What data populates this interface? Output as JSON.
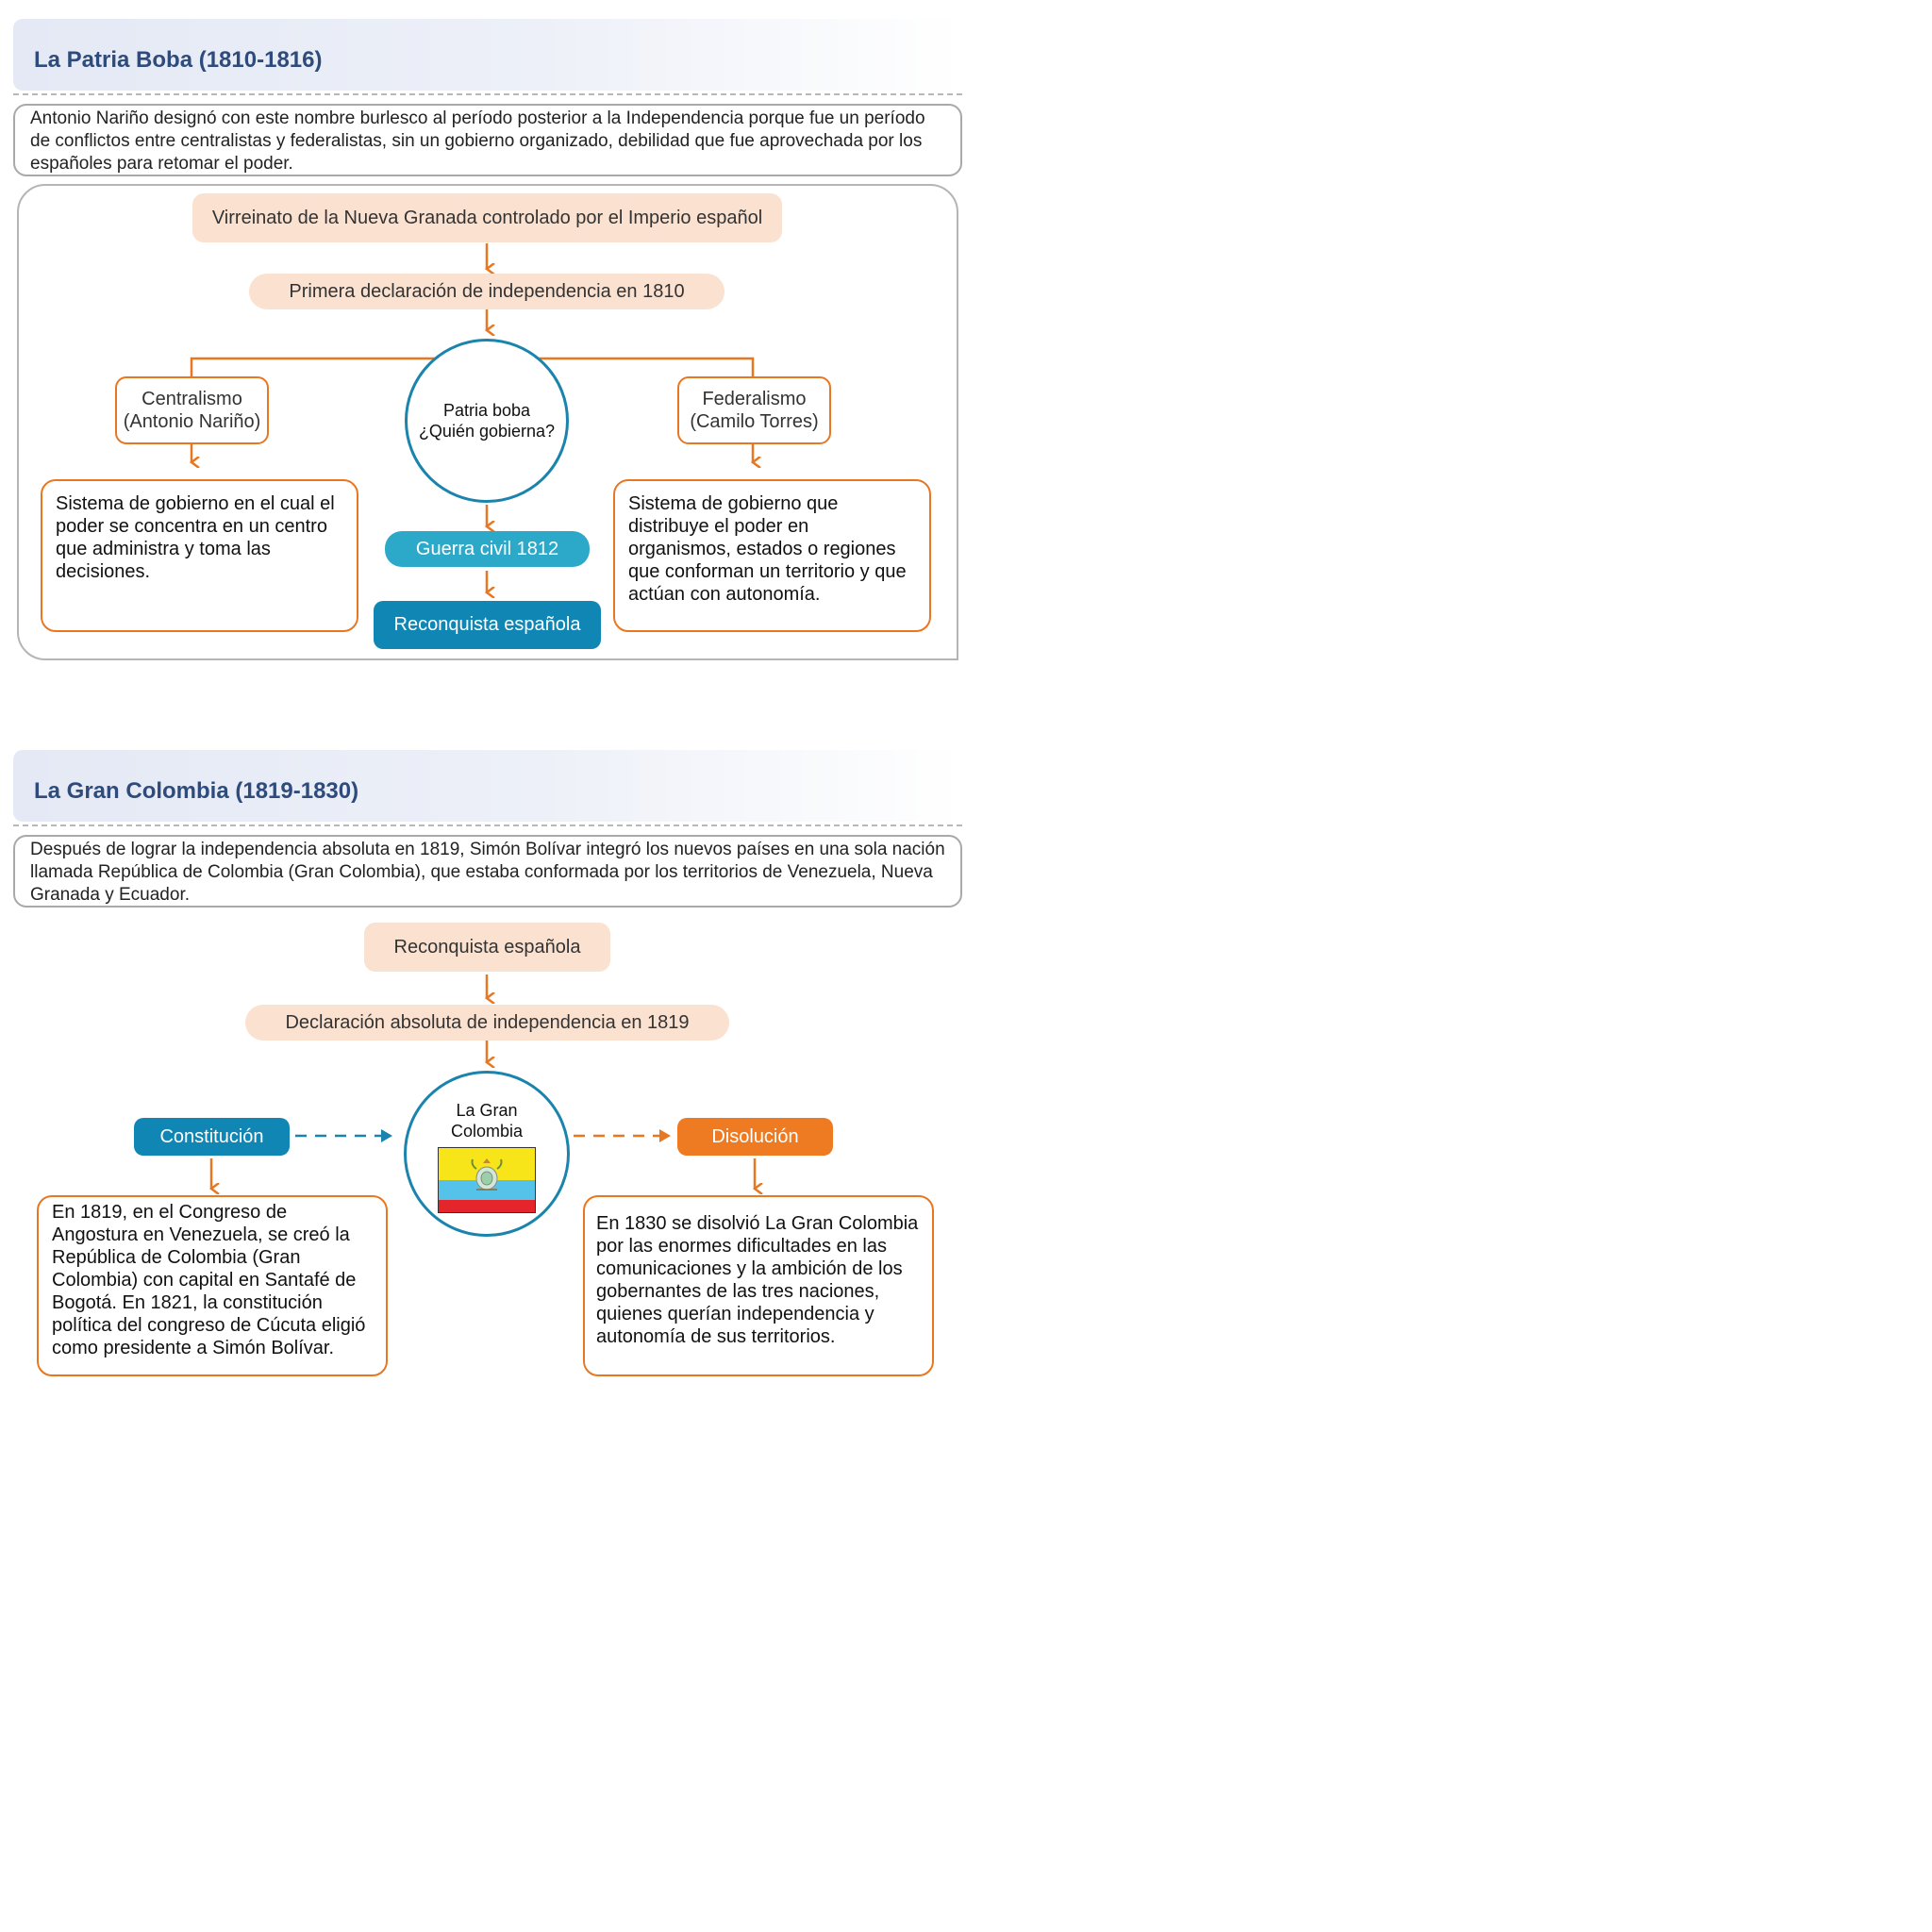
{
  "section1": {
    "title": "La Patria Boba (1810-1816)",
    "intro": "Antonio Nariño designó con este nombre burlesco al período posterior a la Independencia porque fue un período de conflictos entre centralistas y federalistas, sin un gobierno organizado, debilidad que fue aprovechada por los españoles para retomar el poder.",
    "box_top": "Virreinato de la Nueva Granada controlado por el Imperio español",
    "box_second": "Primera declaración de independencia en 1810",
    "circle_line1": "Patria boba",
    "circle_line2": "¿Quién gobierna?",
    "left_label_line1": "Centralismo",
    "left_label_line2": "(Antonio Nariño)",
    "right_label_line1": "Federalismo",
    "right_label_line2": "(Camilo Torres)",
    "left_desc": "Sistema de gobierno en el cual el poder se concentra en un centro que administra y toma las decisiones.",
    "right_desc": "Sistema de gobierno que distribuye el poder en organismos, estados o regiones que conforman un territorio y que actúan con autonomía.",
    "civil_war": "Guerra civil 1812",
    "reconquest": "Reconquista española"
  },
  "section2": {
    "title": "La Gran Colombia (1819-1830)",
    "intro": "Después de lograr la independencia absoluta en 1819, Simón Bolívar integró los nuevos países en una sola nación llamada República de Colombia (Gran Colombia), que estaba conformada por los territorios de Venezuela, Nueva Granada y Ecuador.",
    "box_top": "Reconquista española",
    "box_second": "Declaración absoluta de independencia en 1819",
    "circle_line1": "La Gran",
    "circle_line2": "Colombia",
    "left_label": "Constitución",
    "right_label": "Disolución",
    "left_desc": "En 1819, en el Congreso de Angostura en Venezuela, se creó la República de Colombia (Gran Colombia) con capital en Santafé de Bogotá. En 1821, la constitución política del congreso de Cúcuta eligió como presidente a Simón Bolívar.",
    "right_desc": "En 1830 se disolvió La Gran Colombia por las enormes dificultades en las comunicaciones y la ambición de los gobernantes de las tres naciones, quienes querían independencia y autonomía de sus territorios.",
    "flag_icon": "gran-colombia-flag-icon"
  },
  "colors": {
    "title": "#2f4b7c",
    "orange": "#e87722",
    "teal": "#2ca8c8",
    "blue": "#0f86b4",
    "peach": "#fbe1d0",
    "flag_yellow": "#f7e51a",
    "flag_blue": "#55c2ea",
    "flag_red": "#e4262c"
  }
}
